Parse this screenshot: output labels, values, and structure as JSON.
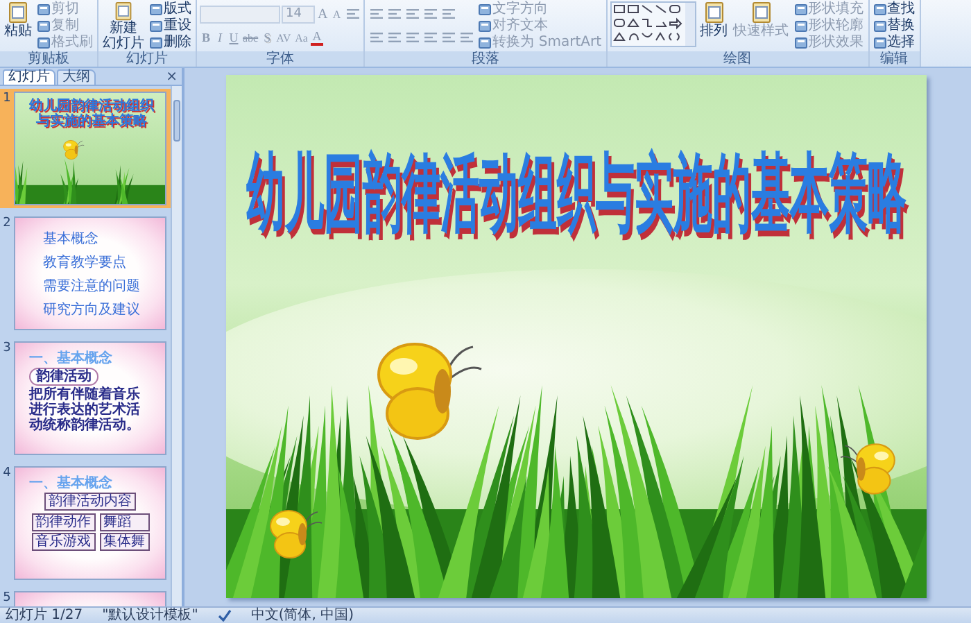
{
  "ribbon": {
    "groups": [
      {
        "label": "剪贴板",
        "columns": [
          [
            {
              "kind": "large",
              "lines": [
                "粘贴"
              ],
              "disabled": false
            }
          ],
          [
            {
              "kind": "small",
              "label": "剪切",
              "disabled": true
            },
            {
              "kind": "small",
              "label": "复制",
              "disabled": true
            },
            {
              "kind": "small",
              "label": "格式刷",
              "disabled": true
            }
          ]
        ]
      },
      {
        "label": "幻灯片",
        "columns": [
          [
            {
              "kind": "large",
              "lines": [
                "新建",
                "幻灯片"
              ],
              "disabled": false
            }
          ],
          [
            {
              "kind": "small",
              "label": "版式",
              "disabled": false
            },
            {
              "kind": "small",
              "label": "重设",
              "disabled": false
            },
            {
              "kind": "small",
              "label": "删除",
              "disabled": false
            }
          ]
        ]
      },
      {
        "label": "字体",
        "columns": [
          [
            {
              "kind": "row",
              "items": [
                {
                  "kind": "field",
                  "disabled": true
                },
                {
                  "kind": "field",
                  "value": "14",
                  "disabled": true
                },
                {
                  "kind": "glyph",
                  "label": "A",
                  "disabled": true
                },
                {
                  "kind": "glyph",
                  "label": "A",
                  "disabled": true
                },
                {
                  "kind": "icon",
                  "disabled": true
                }
              ]
            },
            {
              "kind": "row",
              "items": [
                {
                  "kind": "glyph",
                  "label": "B",
                  "disabled": true
                },
                {
                  "kind": "glyph",
                  "label": "I",
                  "disabled": true
                },
                {
                  "kind": "glyph",
                  "label": "U",
                  "disabled": true
                },
                {
                  "kind": "glyph",
                  "label": "abc",
                  "disabled": true
                },
                {
                  "kind": "glyph",
                  "label": "S",
                  "disabled": true
                },
                {
                  "kind": "glyph",
                  "label": "AV",
                  "disabled": true
                },
                {
                  "kind": "glyph",
                  "label": "Aa",
                  "disabled": true
                },
                {
                  "kind": "glyph",
                  "label": "A",
                  "disabled": true
                }
              ]
            }
          ]
        ]
      },
      {
        "label": "段落",
        "columns": [
          [
            {
              "kind": "row",
              "items": [
                {
                  "kind": "icon",
                  "disabled": true
                },
                {
                  "kind": "icon",
                  "disabled": true
                },
                {
                  "kind": "icon",
                  "disabled": true
                },
                {
                  "kind": "icon",
                  "disabled": true
                },
                {
                  "kind": "icon",
                  "disabled": true
                }
              ]
            },
            {
              "kind": "row",
              "items": [
                {
                  "kind": "icon",
                  "disabled": true
                },
                {
                  "kind": "icon",
                  "disabled": true
                },
                {
                  "kind": "icon",
                  "disabled": true
                },
                {
                  "kind": "icon",
                  "disabled": true
                },
                {
                  "kind": "icon",
                  "disabled": true
                },
                {
                  "kind": "icon",
                  "disabled": true
                }
              ]
            }
          ],
          [
            {
              "kind": "small",
              "label": "文字方向",
              "disabled": true
            },
            {
              "kind": "small",
              "label": "对齐文本",
              "disabled": true
            },
            {
              "kind": "small",
              "label": "转换为 SmartArt",
              "disabled": true
            }
          ]
        ]
      },
      {
        "label": "绘图",
        "columns": [
          [
            {
              "kind": "gallery"
            }
          ],
          [
            {
              "kind": "large",
              "lines": [
                "排列"
              ],
              "disabled": false
            }
          ],
          [
            {
              "kind": "large",
              "lines": [
                "快速样式"
              ],
              "disabled": true
            }
          ],
          [
            {
              "kind": "small",
              "label": "形状填充",
              "disabled": true
            },
            {
              "kind": "small",
              "label": "形状轮廓",
              "disabled": true
            },
            {
              "kind": "small",
              "label": "形状效果",
              "disabled": true
            }
          ]
        ]
      },
      {
        "label": "编辑",
        "columns": [
          [
            {
              "kind": "small",
              "label": "查找",
              "disabled": false
            },
            {
              "kind": "small",
              "label": "替换",
              "disabled": false
            },
            {
              "kind": "small",
              "label": "选择",
              "disabled": false
            }
          ]
        ]
      }
    ]
  },
  "pane": {
    "tabs": [
      {
        "label": "幻灯片",
        "selected": true
      },
      {
        "label": "大纲",
        "selected": false
      }
    ],
    "close": "×"
  },
  "slides": [
    {
      "number": "1",
      "selected": true,
      "kind": "title",
      "title": "幼儿园韵律活动组织与实施的基本策略"
    },
    {
      "number": "2",
      "selected": false,
      "kind": "list",
      "items": [
        "基本概念",
        "教育教学要点",
        "需要注意的问题",
        "研究方向及建议"
      ]
    },
    {
      "number": "3",
      "selected": false,
      "kind": "definition",
      "heading": "一、基本概念",
      "bubble": "韵律活动",
      "text": "把所有伴随着音乐进行表达的艺术活动统称韵律活动。"
    },
    {
      "number": "4",
      "selected": false,
      "kind": "diagram",
      "heading": "一、基本概念",
      "root": "韵律活动内容",
      "leaves": [
        "韵律动作",
        "舞蹈",
        "音乐游戏",
        "集体舞"
      ]
    },
    {
      "number": "5",
      "selected": false,
      "kind": "blank"
    }
  ],
  "slide": {
    "title": "幼儿园韵律活动组织与实施的基本策略"
  },
  "status_bar": {
    "slide": "幻灯片 1/27",
    "theme": "\"默认设计模板\"",
    "language": "中文(简体, 中国)"
  }
}
